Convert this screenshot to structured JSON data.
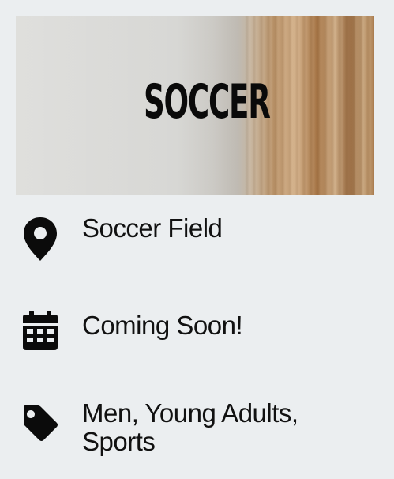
{
  "banner": {
    "title": "SOCCER"
  },
  "details": {
    "location": {
      "icon": "map-pin-icon",
      "text": "Soccer Field"
    },
    "date": {
      "icon": "calendar-icon",
      "text": "Coming Soon!"
    },
    "tags": {
      "icon": "tag-icon",
      "line1": "Men, Young Adults,",
      "line2": "Sports"
    }
  }
}
